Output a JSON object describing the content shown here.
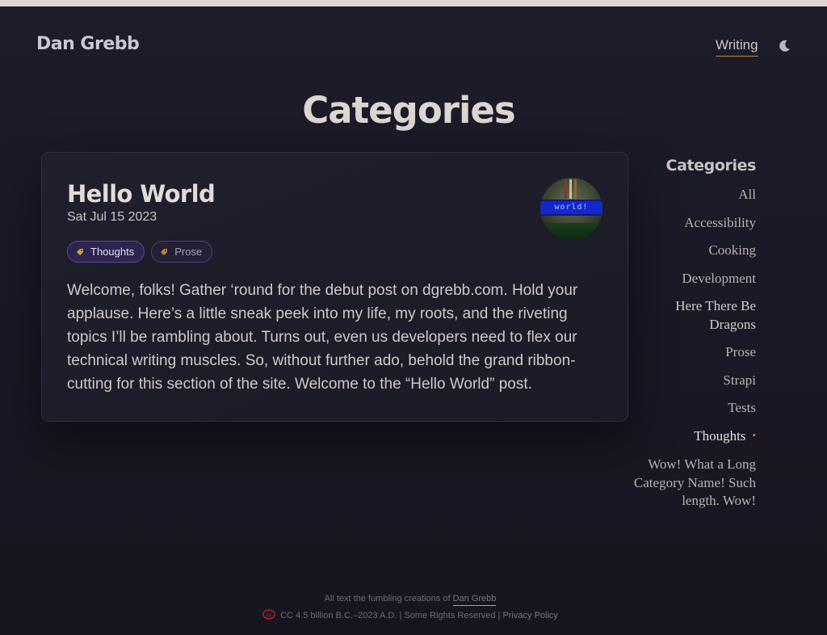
{
  "header": {
    "site_title": "Dan Grebb",
    "nav": {
      "writing_label": "Writing"
    },
    "theme_toggle_icon": "moon-icon"
  },
  "page": {
    "title": "Categories"
  },
  "post": {
    "title": "Hello World",
    "date": "Sat Jul 15 2023",
    "tags": [
      {
        "label": "Thoughts",
        "icon": "tag-icon"
      },
      {
        "label": "Prose",
        "icon": "tag-icon"
      }
    ],
    "excerpt": "Welcome, folks! Gather ‘round for the debut post on dgrebb.com. Hold your applause. Here’s a little sneak peek into my life, my roots, and the riveting topics I’ll be rambling about. Turns out, even us developers need to flex our technical writing muscles. So, without further ado, behold the grand ribbon-cutting for this section of the site. Welcome to the “Hello World” post.",
    "thumbnail_text": "world!"
  },
  "sidebar": {
    "heading": "Categories",
    "items": [
      {
        "label": "All"
      },
      {
        "label": "Accessibility"
      },
      {
        "label": "Cooking"
      },
      {
        "label": "Development"
      },
      {
        "label": "Here There Be Dragons"
      },
      {
        "label": "Prose"
      },
      {
        "label": "Strapi"
      },
      {
        "label": "Tests"
      },
      {
        "label": "Thoughts"
      },
      {
        "label": "Wow! What a Long Category Name! Such length. Wow!"
      }
    ],
    "current_marker": "•"
  },
  "footer": {
    "line1_prefix": "All text the fumbling creations of",
    "author_link": "Dan Grebb",
    "license_text": "CC 4.5 billion B.C.–2023 A.D. | Some Rights Reserved |",
    "privacy_link": "Privacy Policy",
    "license_icon": "creative-commons-icon"
  },
  "colors": {
    "background": "#1a1926",
    "accent": "#c98a2e",
    "tag_active_bg": "#2e2450",
    "tag_border": "#5a47a3"
  }
}
